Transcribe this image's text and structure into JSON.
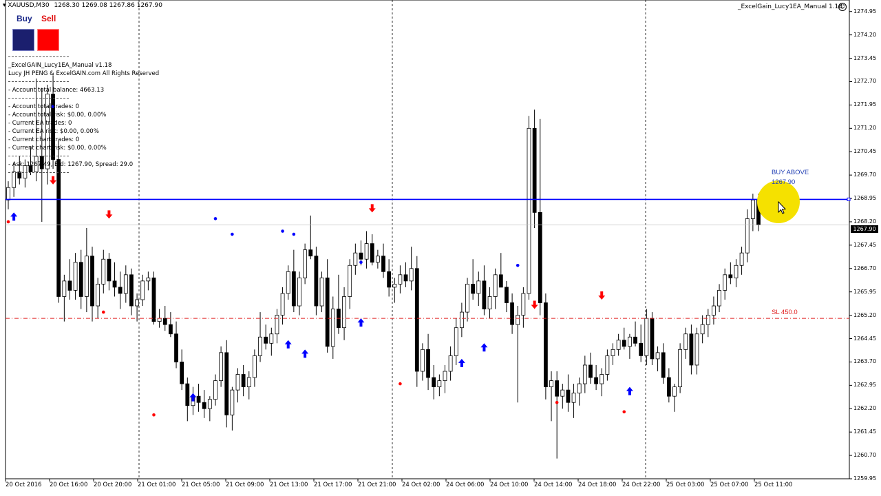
{
  "header": {
    "symbol": "XAUUSD,M30",
    "ohlc": "1268.30 1269.08 1267.86 1267.90",
    "ea_name": "_ExcelGain_Lucy1EA_Manual 1.18"
  },
  "buttons": {
    "buy_label": "Buy",
    "sell_label": "Sell",
    "buy_color": "#1b1f6e",
    "sell_color": "#ff0000"
  },
  "info_panel": {
    "title": "_ExcelGAIN_Lucy1EA_Manual v1.18",
    "copyright": "Lucy JH PENG & ExcelGAIN.com All Rights Reserved",
    "account_balance": "- Account total balance:  4663.13",
    "lines": [
      "- Account total trades:  0",
      "- Account total risk:  $0.00, 0.00%",
      "- Current EA trades:  0",
      "- Current EA risk:  $0.00, 0.00%",
      "- Current chart trades:  0",
      "- Current chart risk:  $0.00, 0.00%"
    ],
    "quote": "- Ask: 1267.49, Bid: 1267.90, Spread: 29.0"
  },
  "lines": {
    "buy_above_title": "BUY ABOVE",
    "buy_above_price": "1267.90",
    "sl_label": "SL 450.0",
    "current_price": "1267.90",
    "buy_line_color": "#0000ff",
    "sl_line_color": "#e02020"
  },
  "price_axis": [
    "1274.95",
    "1274.20",
    "1273.45",
    "1272.70",
    "1271.95",
    "1271.20",
    "1270.45",
    "1269.70",
    "1268.95",
    "1268.20",
    "1267.45",
    "1266.70",
    "1265.95",
    "1265.20",
    "1264.45",
    "1263.70",
    "1262.95",
    "1262.20",
    "1261.45",
    "1260.70",
    "1259.95"
  ],
  "time_axis": [
    "20 Oct 2016",
    "20 Oct 16:00",
    "20 Oct 20:00",
    "21 Oct 01:00",
    "21 Oct 05:00",
    "21 Oct 09:00",
    "21 Oct 13:00",
    "21 Oct 17:00",
    "21 Oct 21:00",
    "24 Oct 02:00",
    "24 Oct 06:00",
    "24 Oct 10:00",
    "24 Oct 14:00",
    "24 Oct 18:00",
    "24 Oct 22:00",
    "25 Oct 03:00",
    "25 Oct 07:00",
    "25 Oct 11:00"
  ],
  "chart_data": {
    "type": "candlestick",
    "ylim": [
      1259.95,
      1275.32
    ],
    "colors": {
      "bull": "#ffffff",
      "bear": "#000000",
      "up_arrow": "#0000ff",
      "down_arrow": "#ff0000"
    },
    "candles": [
      [
        1268.9,
        1269.5,
        1268.6,
        1269.3
      ],
      [
        1269.3,
        1270.1,
        1269.0,
        1269.8
      ],
      [
        1269.8,
        1270.3,
        1269.4,
        1269.6
      ],
      [
        1269.6,
        1270.2,
        1269.3,
        1270.0
      ],
      [
        1270.0,
        1270.6,
        1269.7,
        1269.8
      ],
      [
        1269.8,
        1272.8,
        1269.5,
        1270.3
      ],
      [
        1270.3,
        1272.5,
        1268.2,
        1269.9
      ],
      [
        1269.9,
        1272.6,
        1269.4,
        1272.3
      ],
      [
        1272.3,
        1272.9,
        1269.9,
        1270.2
      ],
      [
        1270.2,
        1270.8,
        1265.6,
        1265.8
      ],
      [
        1265.8,
        1266.5,
        1265.0,
        1266.3
      ],
      [
        1266.3,
        1267.0,
        1265.7,
        1266.0
      ],
      [
        1266.0,
        1267.2,
        1265.7,
        1266.9
      ],
      [
        1266.9,
        1267.3,
        1265.4,
        1265.8
      ],
      [
        1265.8,
        1268.0,
        1265.3,
        1267.1
      ],
      [
        1267.1,
        1267.4,
        1265.0,
        1265.5
      ],
      [
        1265.5,
        1266.4,
        1265.1,
        1266.2
      ],
      [
        1266.2,
        1267.3,
        1265.9,
        1267.0
      ],
      [
        1267.0,
        1267.2,
        1266.0,
        1266.3
      ],
      [
        1266.3,
        1266.9,
        1265.8,
        1266.1
      ],
      [
        1266.1,
        1266.6,
        1265.4,
        1265.9
      ],
      [
        1265.9,
        1266.8,
        1265.6,
        1266.5
      ],
      [
        1266.5,
        1266.7,
        1265.2,
        1265.5
      ],
      [
        1265.5,
        1265.9,
        1265.0,
        1265.7
      ],
      [
        1265.7,
        1266.5,
        1265.5,
        1266.3
      ],
      [
        1266.3,
        1266.6,
        1266.0,
        1266.4
      ],
      [
        1266.4,
        1266.6,
        1264.9,
        1265.0
      ],
      [
        1265.0,
        1265.4,
        1264.8,
        1265.1
      ],
      [
        1265.1,
        1265.5,
        1264.7,
        1264.9
      ],
      [
        1264.9,
        1265.3,
        1264.5,
        1264.6
      ],
      [
        1264.6,
        1265.0,
        1263.5,
        1263.7
      ],
      [
        1263.7,
        1264.1,
        1262.8,
        1263.0
      ],
      [
        1263.0,
        1263.2,
        1261.8,
        1262.3
      ],
      [
        1262.3,
        1262.9,
        1262.0,
        1262.6
      ],
      [
        1262.6,
        1263.0,
        1262.1,
        1262.4
      ],
      [
        1262.4,
        1262.8,
        1261.9,
        1262.2
      ],
      [
        1262.2,
        1262.6,
        1261.8,
        1262.5
      ],
      [
        1262.5,
        1263.3,
        1262.3,
        1263.1
      ],
      [
        1263.1,
        1264.2,
        1262.9,
        1264.0
      ],
      [
        1264.0,
        1264.4,
        1261.6,
        1262.0
      ],
      [
        1262.0,
        1262.9,
        1261.5,
        1262.8
      ],
      [
        1262.8,
        1263.5,
        1262.4,
        1263.3
      ],
      [
        1263.3,
        1263.6,
        1262.6,
        1262.9
      ],
      [
        1262.9,
        1263.4,
        1262.5,
        1263.2
      ],
      [
        1263.2,
        1264.1,
        1262.9,
        1263.9
      ],
      [
        1263.9,
        1265.3,
        1263.7,
        1264.5
      ],
      [
        1264.5,
        1264.9,
        1264.1,
        1264.3
      ],
      [
        1264.3,
        1264.8,
        1263.9,
        1264.6
      ],
      [
        1264.6,
        1265.4,
        1264.3,
        1265.2
      ],
      [
        1265.2,
        1266.1,
        1264.9,
        1265.9
      ],
      [
        1265.9,
        1266.8,
        1265.7,
        1266.6
      ],
      [
        1266.6,
        1267.3,
        1265.3,
        1265.5
      ],
      [
        1265.5,
        1266.6,
        1265.2,
        1266.4
      ],
      [
        1266.4,
        1267.5,
        1266.2,
        1267.3
      ],
      [
        1267.3,
        1268.4,
        1267.0,
        1267.1
      ],
      [
        1267.1,
        1267.4,
        1265.2,
        1265.5
      ],
      [
        1265.5,
        1266.6,
        1265.3,
        1266.4
      ],
      [
        1266.4,
        1267.0,
        1264.0,
        1264.2
      ],
      [
        1264.2,
        1265.8,
        1263.8,
        1265.4
      ],
      [
        1265.4,
        1266.5,
        1264.6,
        1264.8
      ],
      [
        1264.8,
        1266.1,
        1264.4,
        1265.8
      ],
      [
        1265.8,
        1267.0,
        1265.4,
        1266.8
      ],
      [
        1266.8,
        1267.5,
        1266.5,
        1267.2
      ],
      [
        1267.2,
        1267.6,
        1266.8,
        1267.0
      ],
      [
        1267.0,
        1267.9,
        1266.7,
        1267.5
      ],
      [
        1267.5,
        1267.8,
        1266.8,
        1266.9
      ],
      [
        1266.9,
        1267.3,
        1266.7,
        1267.1
      ],
      [
        1267.1,
        1267.5,
        1266.4,
        1266.6
      ],
      [
        1266.6,
        1267.0,
        1265.8,
        1266.1
      ],
      [
        1266.1,
        1266.4,
        1265.6,
        1266.2
      ],
      [
        1266.2,
        1266.8,
        1265.9,
        1266.5
      ],
      [
        1266.5,
        1266.9,
        1266.1,
        1266.3
      ],
      [
        1266.3,
        1267.4,
        1266.0,
        1266.7
      ],
      [
        1266.7,
        1267.1,
        1262.9,
        1263.4
      ],
      [
        1263.4,
        1264.3,
        1263.1,
        1264.1
      ],
      [
        1264.1,
        1264.6,
        1262.8,
        1263.2
      ],
      [
        1263.2,
        1263.6,
        1262.5,
        1262.9
      ],
      [
        1262.9,
        1263.3,
        1262.6,
        1263.1
      ],
      [
        1263.1,
        1263.6,
        1262.7,
        1263.4
      ],
      [
        1263.4,
        1264.2,
        1263.1,
        1263.9
      ],
      [
        1263.9,
        1265.1,
        1263.6,
        1264.8
      ],
      [
        1264.8,
        1265.6,
        1264.5,
        1265.3
      ],
      [
        1265.3,
        1266.4,
        1265.0,
        1266.2
      ],
      [
        1266.2,
        1267.0,
        1265.7,
        1265.9
      ],
      [
        1265.9,
        1266.6,
        1265.5,
        1266.3
      ],
      [
        1266.3,
        1266.8,
        1265.2,
        1265.4
      ],
      [
        1265.4,
        1266.1,
        1265.1,
        1265.8
      ],
      [
        1265.8,
        1266.7,
        1265.4,
        1266.5
      ],
      [
        1266.5,
        1267.2,
        1266.1,
        1266.1
      ],
      [
        1266.1,
        1266.3,
        1265.3,
        1265.6
      ],
      [
        1265.6,
        1265.9,
        1264.6,
        1264.9
      ],
      [
        1264.9,
        1265.5,
        1262.4,
        1265.2
      ],
      [
        1265.2,
        1266.1,
        1264.8,
        1265.9
      ],
      [
        1265.9,
        1271.6,
        1265.7,
        1271.2
      ],
      [
        1271.2,
        1271.8,
        1268.0,
        1268.5
      ],
      [
        1268.5,
        1271.5,
        1265.2,
        1265.6
      ],
      [
        1265.6,
        1265.9,
        1262.5,
        1262.9
      ],
      [
        1262.9,
        1263.4,
        1261.8,
        1263.1
      ],
      [
        1263.1,
        1263.4,
        1260.6,
        1262.6
      ],
      [
        1262.6,
        1263.0,
        1262.2,
        1262.8
      ],
      [
        1262.8,
        1263.3,
        1262.1,
        1262.4
      ],
      [
        1262.4,
        1263.0,
        1261.9,
        1262.7
      ],
      [
        1262.7,
        1263.2,
        1262.3,
        1263.0
      ],
      [
        1263.0,
        1263.9,
        1262.7,
        1263.6
      ],
      [
        1263.6,
        1264.0,
        1263.0,
        1263.2
      ],
      [
        1263.2,
        1263.6,
        1262.8,
        1263.0
      ],
      [
        1263.0,
        1263.5,
        1262.6,
        1263.3
      ],
      [
        1263.3,
        1264.1,
        1263.1,
        1263.9
      ],
      [
        1263.9,
        1264.3,
        1263.6,
        1264.1
      ],
      [
        1264.1,
        1264.6,
        1263.9,
        1264.4
      ],
      [
        1264.4,
        1264.8,
        1264.1,
        1264.2
      ],
      [
        1264.2,
        1264.6,
        1263.8,
        1264.5
      ],
      [
        1264.5,
        1265.0,
        1264.2,
        1264.3
      ],
      [
        1264.3,
        1264.9,
        1263.7,
        1263.9
      ],
      [
        1263.9,
        1265.4,
        1263.6,
        1265.1
      ],
      [
        1265.1,
        1265.3,
        1263.6,
        1263.8
      ],
      [
        1263.8,
        1264.2,
        1263.4,
        1264.0
      ],
      [
        1264.0,
        1264.3,
        1263.0,
        1263.2
      ],
      [
        1263.2,
        1263.5,
        1262.4,
        1262.6
      ],
      [
        1262.6,
        1263.0,
        1262.1,
        1262.9
      ],
      [
        1262.9,
        1264.3,
        1262.7,
        1264.1
      ],
      [
        1264.1,
        1264.8,
        1263.8,
        1264.6
      ],
      [
        1264.6,
        1264.9,
        1263.3,
        1263.6
      ],
      [
        1263.6,
        1264.8,
        1263.3,
        1264.6
      ],
      [
        1264.6,
        1265.2,
        1264.3,
        1264.9
      ],
      [
        1264.9,
        1265.4,
        1264.5,
        1265.2
      ],
      [
        1265.2,
        1265.8,
        1264.9,
        1265.5
      ],
      [
        1265.5,
        1266.2,
        1265.3,
        1266.0
      ],
      [
        1266.0,
        1266.7,
        1265.7,
        1266.5
      ],
      [
        1266.5,
        1266.9,
        1266.2,
        1266.4
      ],
      [
        1266.4,
        1267.0,
        1266.1,
        1266.8
      ],
      [
        1266.8,
        1267.4,
        1266.5,
        1267.2
      ],
      [
        1267.2,
        1268.6,
        1266.9,
        1268.3
      ],
      [
        1268.3,
        1269.1,
        1267.9,
        1268.9
      ],
      [
        1268.9,
        1269.1,
        1267.9,
        1268.1
      ]
    ],
    "up_arrows": [
      [
        1,
        1268.5
      ],
      [
        33,
        1262.7
      ],
      [
        50,
        1264.4
      ],
      [
        53,
        1264.1
      ],
      [
        63,
        1265.1
      ],
      [
        81,
        1263.8
      ],
      [
        85,
        1264.3
      ],
      [
        111,
        1262.9
      ]
    ],
    "down_arrows": [
      [
        8,
        1269.4
      ],
      [
        18,
        1268.3
      ],
      [
        65,
        1268.5
      ],
      [
        94,
        1265.4
      ],
      [
        106,
        1265.7
      ]
    ],
    "red_dots": [
      [
        0,
        1268.2
      ],
      [
        17,
        1265.3
      ],
      [
        26,
        1262.0
      ],
      [
        70,
        1263.0
      ],
      [
        98,
        1262.4
      ],
      [
        110,
        1262.1
      ]
    ],
    "blue_dots": [
      [
        8,
        1271.9
      ],
      [
        37,
        1268.3
      ],
      [
        40,
        1267.8
      ],
      [
        49,
        1267.9
      ],
      [
        51,
        1267.8
      ],
      [
        63,
        1266.9
      ],
      [
        91,
        1266.8
      ]
    ],
    "buy_above_line": 1268.92,
    "sl_line": 1265.1,
    "current_price_line": 1268.1
  }
}
